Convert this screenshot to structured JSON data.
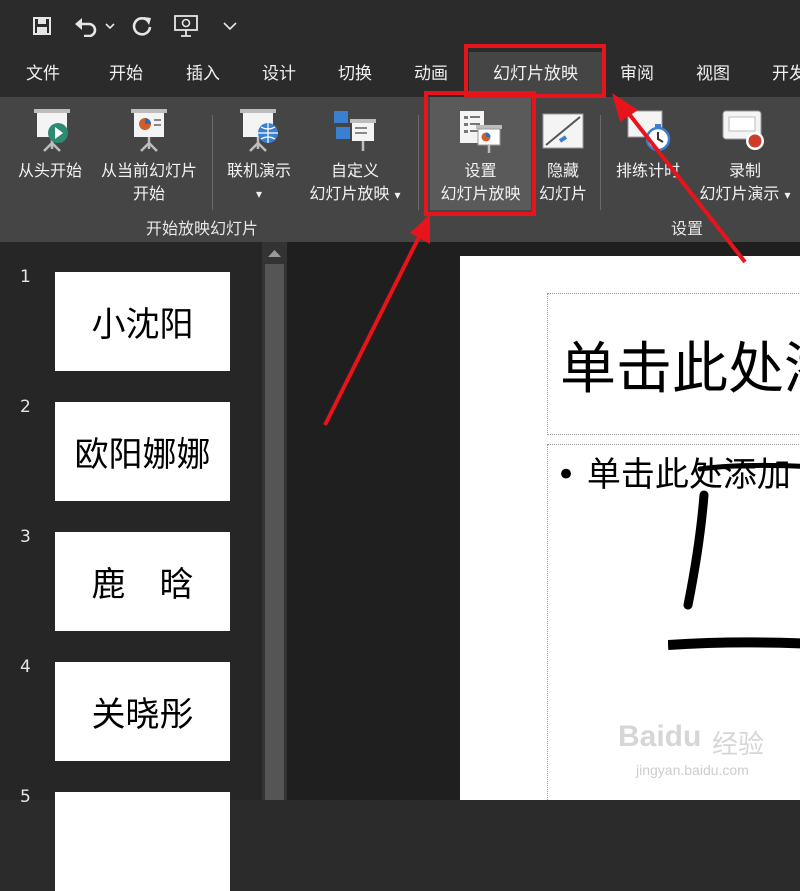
{
  "quick_access": {
    "icons": [
      "save-icon",
      "undo-icon",
      "dropdown-arrow-icon",
      "redo-icon",
      "present-from-start-icon",
      "customize-dropdown-icon"
    ]
  },
  "tabs": [
    "文件",
    "开始",
    "插入",
    "设计",
    "切换",
    "动画",
    "幻灯片放映",
    "审阅",
    "视图",
    "开发"
  ],
  "ribbon": {
    "from_beginning": "从头开始",
    "from_current_line1": "从当前幻灯片",
    "from_current_line2": "开始",
    "online_present": "联机演示",
    "custom_line1": "自定义",
    "custom_line2": "幻灯片放映",
    "setup_line1": "设置",
    "setup_line2": "幻灯片放映",
    "hide_line1": "隐藏",
    "hide_line2": "幻灯片",
    "rehearse": "排练计时",
    "record_line1": "录制",
    "record_line2": "幻灯片演示",
    "dropdown_glyph": "▾",
    "group_start": "开始放映幻灯片",
    "group_setup": "设置"
  },
  "slides": [
    {
      "num": "1",
      "title": "小沈阳"
    },
    {
      "num": "2",
      "title": "欧阳娜娜"
    },
    {
      "num": "3",
      "title": "鹿　晗"
    },
    {
      "num": "4",
      "title": "关晓彤"
    },
    {
      "num": "5",
      "title": ""
    }
  ],
  "slide_view": {
    "title_placeholder": "单击此处添",
    "bullet_text": "• 单击此处添加"
  },
  "watermark": {
    "brand": "Baidu",
    "brand_cn": "经验",
    "url": "jingyan.baidu.com"
  },
  "colors": {
    "highlight_red": "#e8141b",
    "tab_bg": "#2b2b2b",
    "ribbon_bg": "#454545"
  }
}
